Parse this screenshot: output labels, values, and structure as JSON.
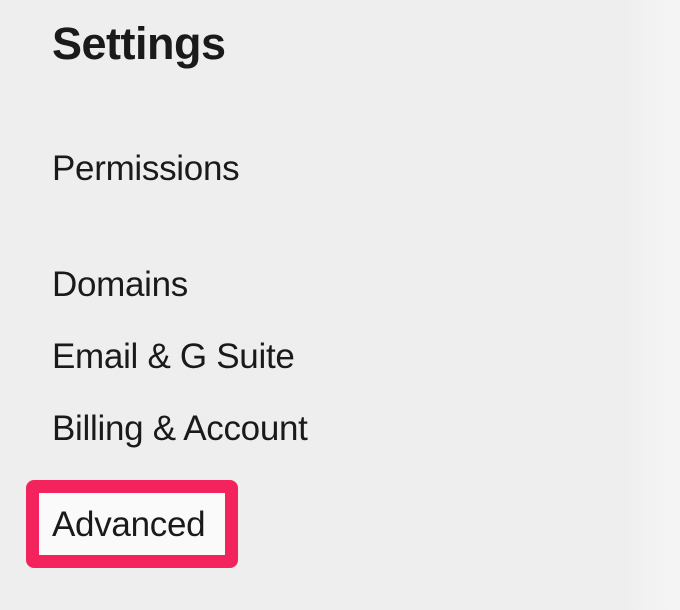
{
  "settings": {
    "title": "Settings",
    "nav": {
      "permissions": "Permissions",
      "domains": "Domains",
      "email_gsuite": "Email & G Suite",
      "billing_account": "Billing & Account",
      "advanced": "Advanced"
    },
    "highlight_color": "#f3245d"
  }
}
